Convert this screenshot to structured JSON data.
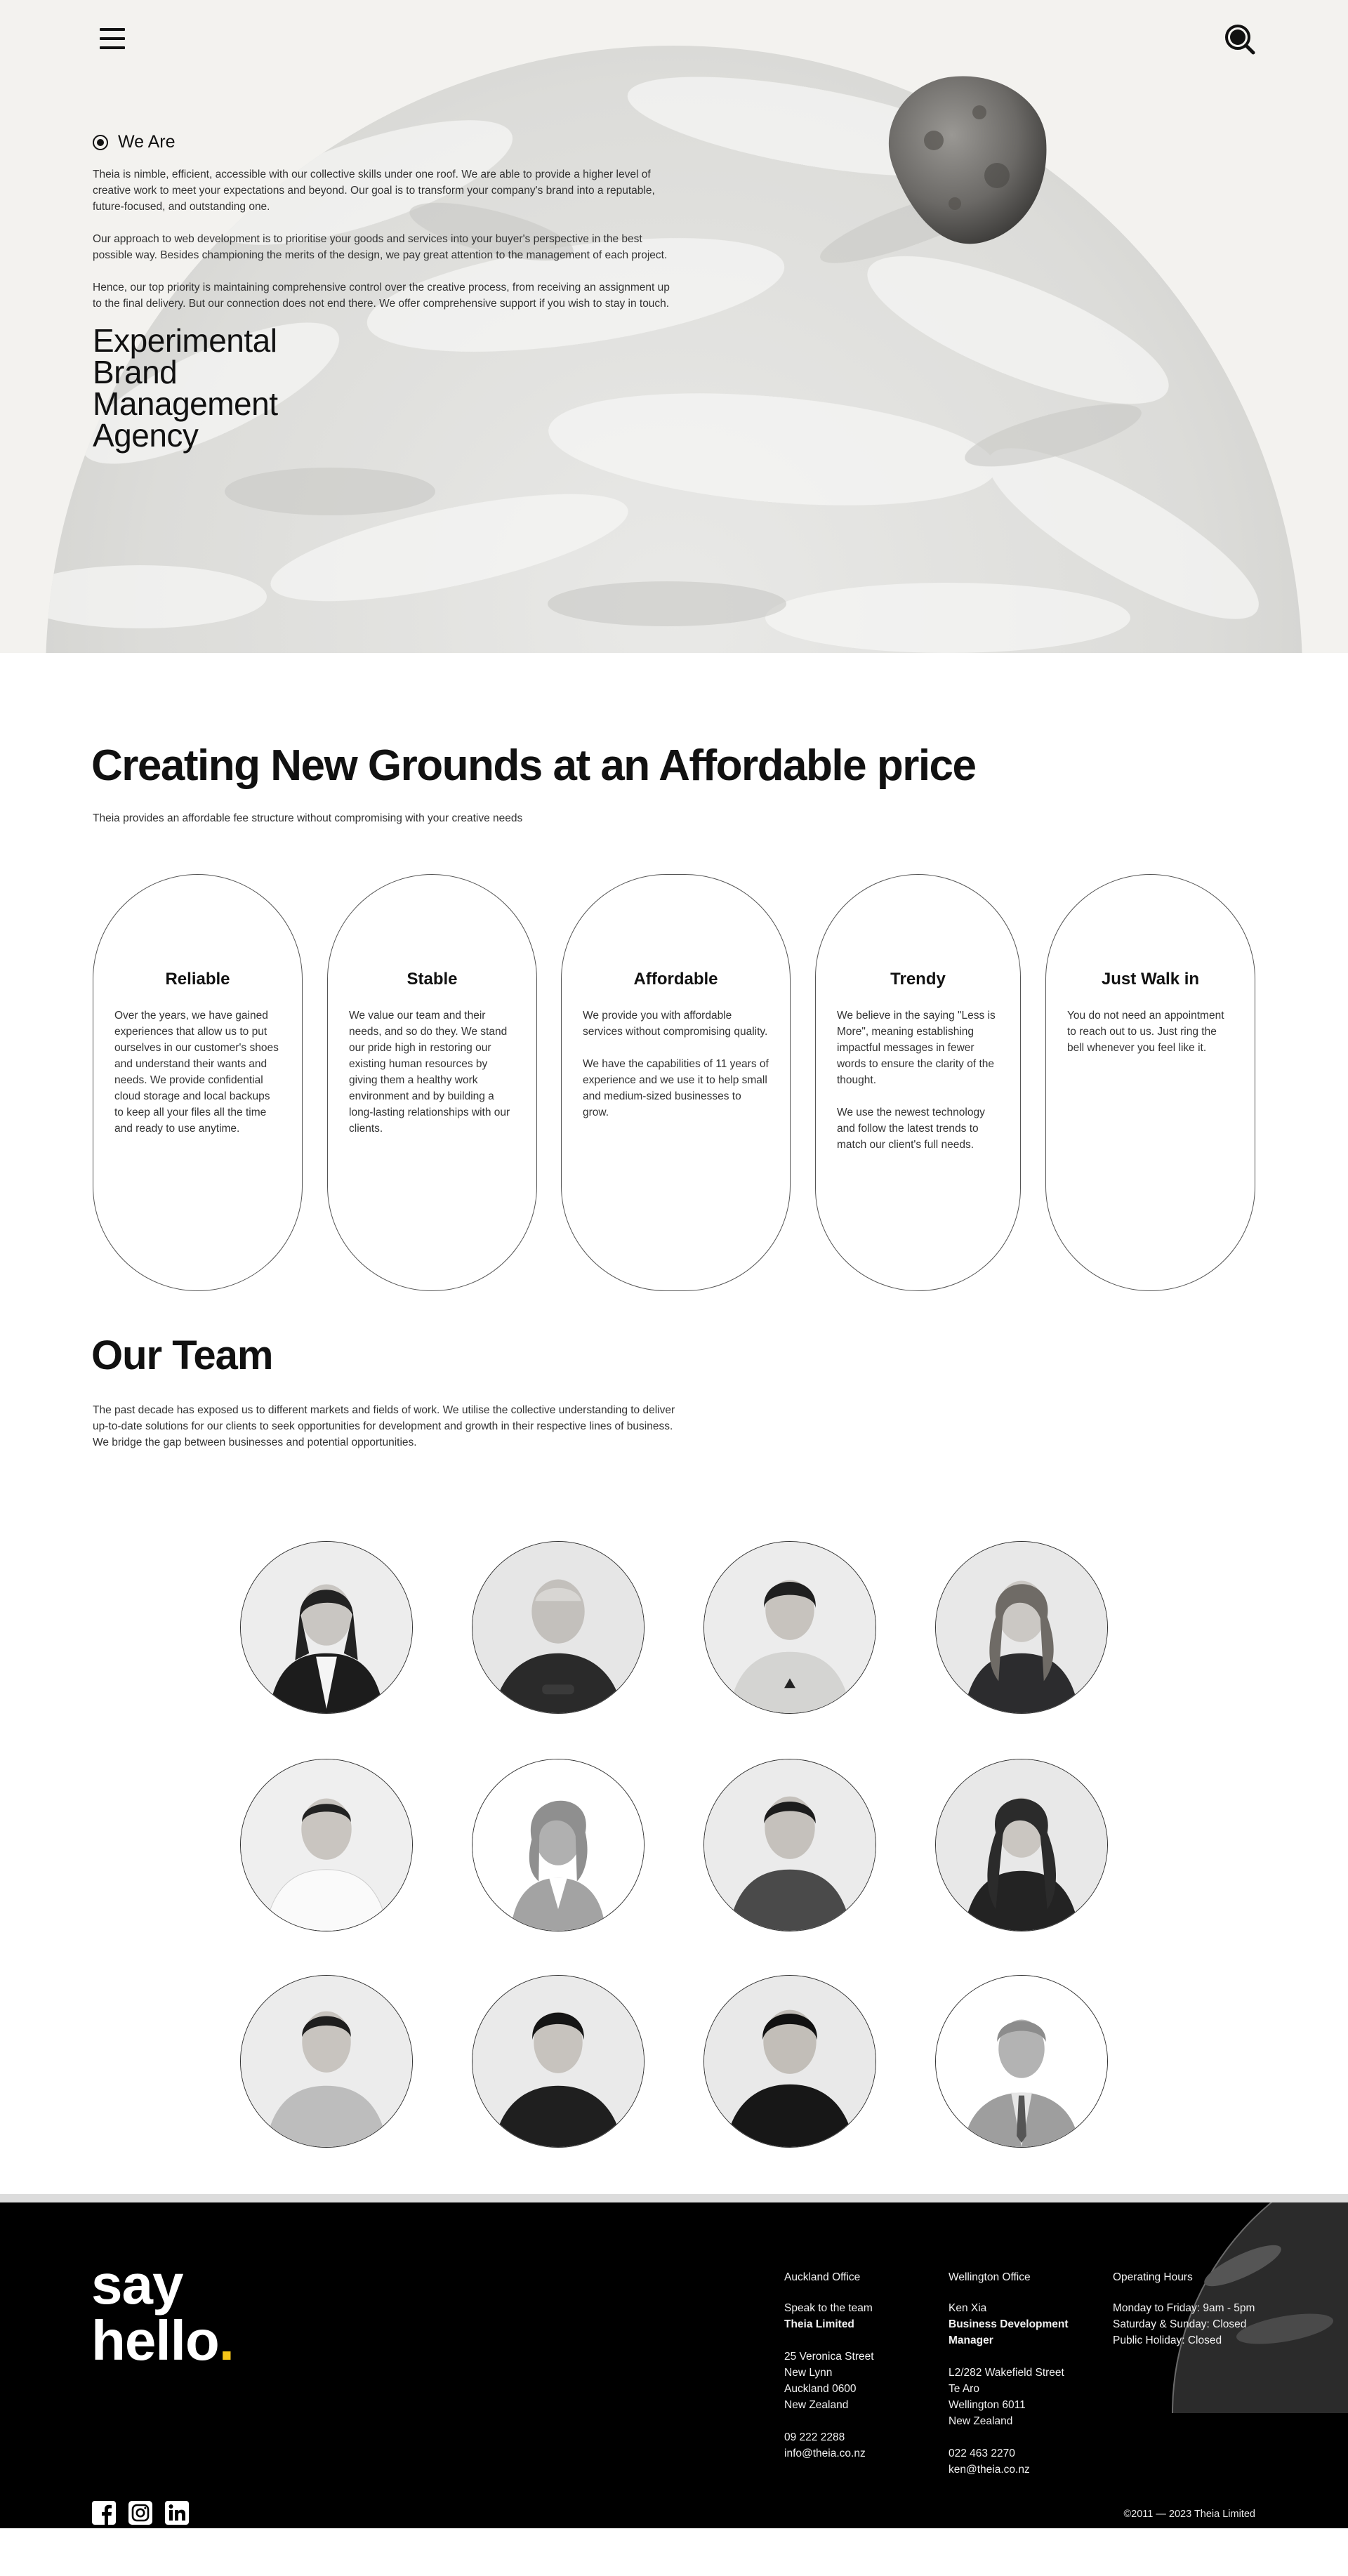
{
  "hero": {
    "menu_icon": "hamburger-menu-icon",
    "search_icon": "search-icon",
    "label": "We Are",
    "paragraphs": [
      "Theia is nimble, efficient, accessible with our collective skills under one roof. We are able to provide a higher level of creative work to meet your expectations and beyond. Our goal is to transform your company's brand into a reputable, future-focused, and outstanding one.",
      "Our approach to web development is to prioritise your goods and services into your buyer's perspective in the best possible way. Besides championing the merits of the design, we pay great attention to the management of each project.",
      "Hence, our top priority is maintaining comprehensive control over the creative process, from receiving an assignment up to the final delivery. But our connection does not end there. We offer comprehensive support if you wish to stay in touch."
    ],
    "title_lines": [
      "Experimental",
      "Brand",
      "Management",
      "Agency"
    ]
  },
  "pricing": {
    "title": "Creating New Grounds at an Affordable price",
    "subtitle": "Theia provides an affordable fee structure without compromising with your creative needs",
    "cards": [
      {
        "title": "Reliable",
        "paragraphs": [
          "Over the years, we have gained experiences that allow us to put ourselves in our customer's shoes and understand their wants and needs. We provide confidential cloud storage and local backups to keep all your files all the time and ready to use anytime."
        ]
      },
      {
        "title": "Stable",
        "paragraphs": [
          "We value our team and their needs, and so do they. We stand our pride high in restoring our existing human resources by giving them a healthy work environment and by building a long-lasting relationships with our clients."
        ]
      },
      {
        "title": "Affordable",
        "paragraphs": [
          "We provide you with affordable services without compromising quality.",
          "We have the capabilities of 11 years of experience and we use it to help small and medium-sized businesses to grow."
        ]
      },
      {
        "title": "Trendy",
        "paragraphs": [
          "We believe in the saying \"Less is More\", meaning establishing impactful messages in fewer words to ensure the clarity of the thought.",
          "We use the newest technology and follow the latest trends to match our client's full needs."
        ]
      },
      {
        "title": "Just Walk in",
        "paragraphs": [
          "You do not need an appointment to reach out to us. Just ring the bell whenever you feel like it."
        ]
      }
    ]
  },
  "team": {
    "title": "Our Team",
    "paragraph": "The past decade has exposed us to different markets and fields of work. We utilise the collective understanding to deliver up-to-date solutions for our clients to seek opportunities for development and growth in their respective lines of business. We bridge the gap between businesses and potential opportunities."
  },
  "footer": {
    "say": "say",
    "hello": "hello",
    "dot": ".",
    "accent_color": "#f5c518",
    "auckland": {
      "head": "Auckland Office",
      "speak": "Speak to the team",
      "company": "Theia Limited",
      "address": [
        "25 Veronica Street",
        "New Lynn",
        "Auckland 0600",
        "New Zealand"
      ],
      "phone": "09 222 2288",
      "email": "info@theia.co.nz"
    },
    "wellington": {
      "head": "Wellington Office",
      "name": "Ken Xia",
      "role_lines": [
        "Business Development",
        "Manager"
      ],
      "address": [
        "L2/282 Wakefield Street",
        "Te Aro",
        "Wellington 6011",
        "New Zealand"
      ],
      "phone": "022 463 2270",
      "email": "ken@theia.co.nz"
    },
    "hours": {
      "head": "Operating Hours",
      "lines": [
        "Monday to Friday: 9am - 5pm",
        "Saturday & Sunday: Closed",
        "Public Holiday: Closed"
      ]
    },
    "social_icons": [
      "facebook-icon",
      "instagram-icon",
      "linkedin-icon"
    ],
    "copyright": "©2011 — 2023 Theia Limited"
  }
}
